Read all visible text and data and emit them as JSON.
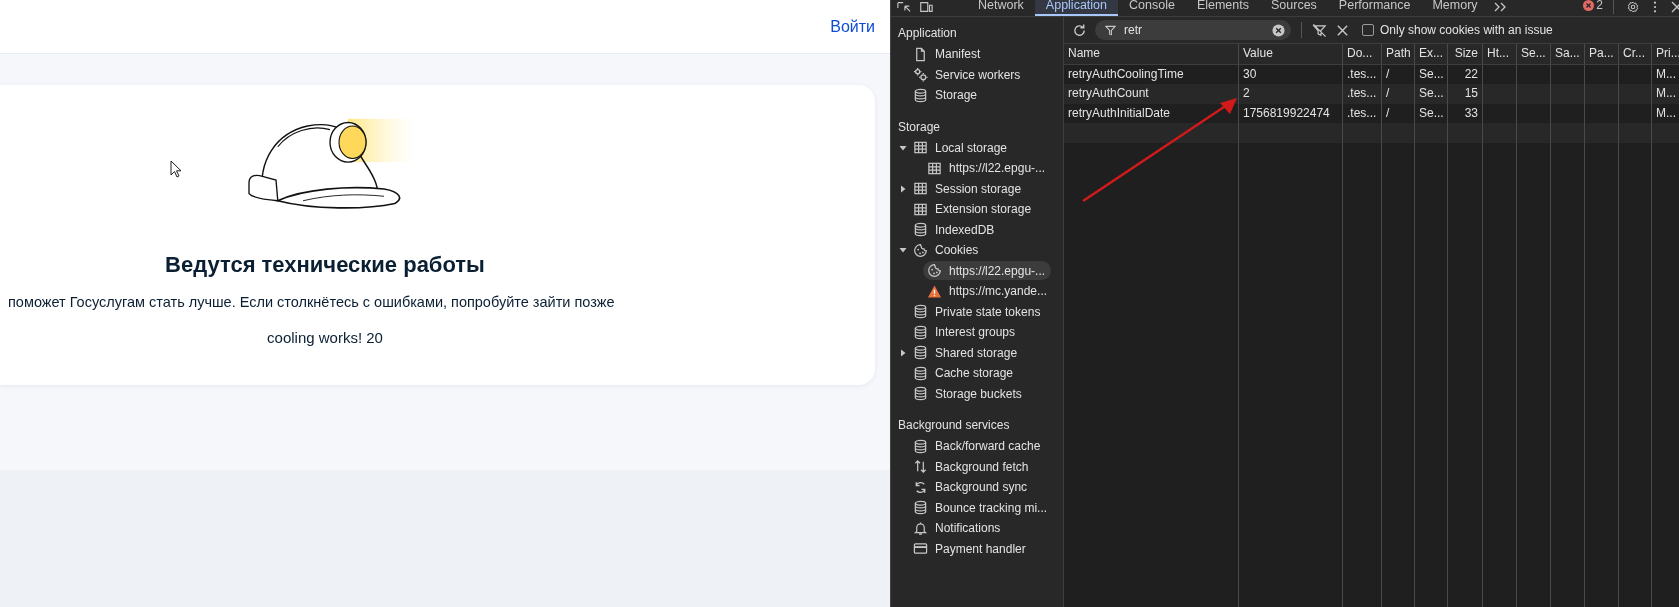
{
  "page": {
    "login_link": "Войти",
    "title": "Ведутся технические работы",
    "description": "поможет Госуслугам стать лучше. Если столкнётесь с ошибками, попробуйте зайти позже",
    "status_text": "cooling works! 20"
  },
  "devtools": {
    "tabs": [
      {
        "label": "Network",
        "selected": false
      },
      {
        "label": "Application",
        "selected": true
      },
      {
        "label": "Console",
        "selected": false
      },
      {
        "label": "Elements",
        "selected": false
      },
      {
        "label": "Sources",
        "selected": false
      },
      {
        "label": "Performance",
        "selected": false
      },
      {
        "label": "Memory",
        "selected": false
      }
    ],
    "error_count": "2",
    "filter": {
      "value": "retr"
    },
    "only_issues": {
      "label": "Only show cookies with an issue",
      "checked": false
    },
    "sidebar": {
      "sections": [
        {
          "title": "Application",
          "items": [
            {
              "label": "Manifest",
              "kind": "file",
              "selected": false
            },
            {
              "label": "Service workers",
              "kind": "gear",
              "selected": false
            },
            {
              "label": "Storage",
              "kind": "database",
              "selected": false
            }
          ]
        },
        {
          "title": "Storage",
          "items": [
            {
              "label": "Local storage",
              "kind": "table",
              "selected": false,
              "expanded": true,
              "children": [
                {
                  "label": "https://l22.epgu-...",
                  "kind": "table",
                  "selected": false
                }
              ]
            },
            {
              "label": "Session storage",
              "kind": "table",
              "selected": false,
              "expanded": false
            },
            {
              "label": "Extension storage",
              "kind": "table",
              "selected": false
            },
            {
              "label": "IndexedDB",
              "kind": "database",
              "selected": false
            },
            {
              "label": "Cookies",
              "kind": "cookie",
              "selected": false,
              "expanded": true,
              "children": [
                {
                  "label": "https://l22.epgu-...",
                  "kind": "cookie",
                  "selected": true
                },
                {
                  "label": "https://mc.yande...",
                  "kind": "warning",
                  "selected": false
                }
              ]
            },
            {
              "label": "Private state tokens",
              "kind": "database",
              "selected": false
            },
            {
              "label": "Interest groups",
              "kind": "database",
              "selected": false
            },
            {
              "label": "Shared storage",
              "kind": "database",
              "selected": false,
              "expanded": false
            },
            {
              "label": "Cache storage",
              "kind": "database",
              "selected": false
            },
            {
              "label": "Storage buckets",
              "kind": "database",
              "selected": false
            }
          ]
        },
        {
          "title": "Background services",
          "items": [
            {
              "label": "Back/forward cache",
              "kind": "database",
              "selected": false
            },
            {
              "label": "Background fetch",
              "kind": "updown",
              "selected": false
            },
            {
              "label": "Background sync",
              "kind": "sync",
              "selected": false
            },
            {
              "label": "Bounce tracking mi...",
              "kind": "database",
              "selected": false
            },
            {
              "label": "Notifications",
              "kind": "bell",
              "selected": false
            },
            {
              "label": "Payment handler",
              "kind": "card",
              "selected": false
            }
          ]
        }
      ]
    },
    "table": {
      "columns": [
        {
          "label": "Name"
        },
        {
          "label": "Value"
        },
        {
          "label": "Do..."
        },
        {
          "label": "Path"
        },
        {
          "label": "Ex..."
        },
        {
          "label": "Size"
        },
        {
          "label": "Ht..."
        },
        {
          "label": "Se..."
        },
        {
          "label": "Sa..."
        },
        {
          "label": "Pa..."
        },
        {
          "label": "Cr..."
        },
        {
          "label": "Pri..."
        }
      ],
      "rows": [
        [
          "retryAuthCoolingTime",
          "30",
          ".tes...",
          "/",
          "Se...",
          "22",
          "",
          "",
          "",
          "",
          "",
          "M..."
        ],
        [
          "retryAuthCount",
          "2",
          ".tes...",
          "/",
          "Se...",
          "15",
          "",
          "",
          "",
          "",
          "",
          "M..."
        ],
        [
          "retryAuthInitialDate",
          "1756819922474",
          ".tes...",
          "/",
          "Se...",
          "33",
          "",
          "",
          "",
          "",
          "",
          "M..."
        ]
      ]
    }
  }
}
